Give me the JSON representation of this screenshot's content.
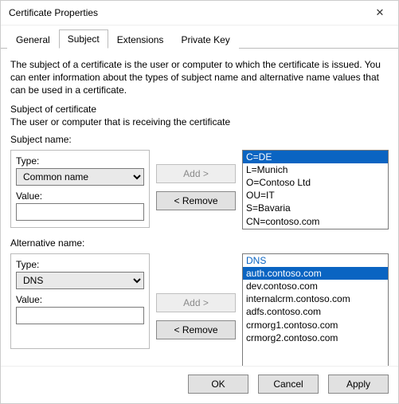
{
  "window": {
    "title": "Certificate Properties",
    "close_glyph": "✕"
  },
  "tabs": {
    "items": [
      {
        "label": "General"
      },
      {
        "label": "Subject"
      },
      {
        "label": "Extensions"
      },
      {
        "label": "Private Key"
      }
    ],
    "active_index": 1
  },
  "intro": "The subject of a certificate is the user or computer to which the certificate is issued. You can enter information about the types of subject name and alternative name values that can be used in a certificate.",
  "subject": {
    "heading": "Subject of certificate",
    "subheading": "The user or computer that is receiving the certificate",
    "name_label": "Subject name:",
    "type_label": "Type:",
    "type_value": "Common name",
    "value_label": "Value:",
    "value_value": "",
    "add_label": "Add >",
    "remove_label": "< Remove",
    "list": [
      "C=DE",
      "L=Munich",
      "O=Contoso Ltd",
      "OU=IT",
      "S=Bavaria",
      "CN=contoso.com"
    ],
    "list_selected_index": 0
  },
  "altname": {
    "name_label": "Alternative name:",
    "type_label": "Type:",
    "type_value": "DNS",
    "value_label": "Value:",
    "value_value": "",
    "add_label": "Add >",
    "remove_label": "< Remove",
    "header": "DNS",
    "list": [
      "auth.contoso.com",
      "dev.contoso.com",
      "internalcrm.contoso.com",
      "adfs.contoso.com",
      "crmorg1.contoso.com",
      "crmorg2.contoso.com"
    ],
    "list_selected_index": 0
  },
  "buttons": {
    "ok": "OK",
    "cancel": "Cancel",
    "apply": "Apply"
  }
}
